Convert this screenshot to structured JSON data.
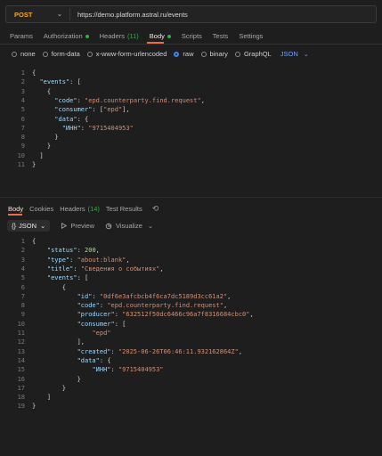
{
  "request": {
    "method": "POST",
    "url": "https://demo.platform.astral.ru/events"
  },
  "request_tabs": [
    {
      "label": "Params"
    },
    {
      "label": "Authorization",
      "dot": true
    },
    {
      "label": "Headers",
      "count": "(11)"
    },
    {
      "label": "Body",
      "dot": true,
      "active": true
    },
    {
      "label": "Scripts"
    },
    {
      "label": "Tests"
    },
    {
      "label": "Settings"
    }
  ],
  "body_types": [
    "none",
    "form-data",
    "x-www-form-urlencoded",
    "raw",
    "binary",
    "GraphQL"
  ],
  "body_format": "JSON",
  "request_body": [
    {
      "n": "1",
      "t": "{"
    },
    {
      "n": "2",
      "t": "  \"events\": ["
    },
    {
      "n": "3",
      "t": "    {"
    },
    {
      "n": "4",
      "t": "      \"code\": \"epd.counterparty.find.request\","
    },
    {
      "n": "5",
      "t": "      \"consumer\": [\"epd\"],"
    },
    {
      "n": "6",
      "t": "      \"data\": {"
    },
    {
      "n": "7",
      "t": "        \"ИНН\": \"9715404953\""
    },
    {
      "n": "8",
      "t": "      }"
    },
    {
      "n": "9",
      "t": "    }"
    },
    {
      "n": "10",
      "t": "  ]"
    },
    {
      "n": "11",
      "t": "}"
    }
  ],
  "response_tabs": [
    {
      "label": "Body",
      "active": true
    },
    {
      "label": "Cookies"
    },
    {
      "label": "Headers",
      "count": "(14)"
    },
    {
      "label": "Test Results"
    }
  ],
  "response_toolbar": {
    "format": "JSON",
    "preview": "Preview",
    "visualize": "Visualize"
  },
  "response_body": [
    {
      "n": "1",
      "t": "{"
    },
    {
      "n": "2",
      "t": "    \"status\": 200,"
    },
    {
      "n": "3",
      "t": "    \"type\": \"about:blank\","
    },
    {
      "n": "4",
      "t": "    \"title\": \"Сведения о событиях\","
    },
    {
      "n": "5",
      "t": "    \"events\": ["
    },
    {
      "n": "6",
      "t": "        {"
    },
    {
      "n": "7",
      "t": "            \"id\": \"0df6e3afcbcb4f6ca7dc5189d3cc61a2\","
    },
    {
      "n": "8",
      "t": "            \"code\": \"epd.counterparty.find.request\","
    },
    {
      "n": "9",
      "t": "            \"producer\": \"632512f50dc6466c96a7f8316684cbc0\","
    },
    {
      "n": "10",
      "t": "            \"consumer\": ["
    },
    {
      "n": "11",
      "t": "                \"epd\""
    },
    {
      "n": "12",
      "t": "            ],"
    },
    {
      "n": "13",
      "t": "            \"created\": \"2025-06-26T06:46:11.932162864Z\","
    },
    {
      "n": "14",
      "t": "            \"data\": {"
    },
    {
      "n": "15",
      "t": "                \"ИНН\": \"9715404953\""
    },
    {
      "n": "16",
      "t": "            }"
    },
    {
      "n": "17",
      "t": "        }"
    },
    {
      "n": "18",
      "t": "    ]"
    },
    {
      "n": "19",
      "t": "}"
    }
  ],
  "colors": {
    "method": "#f0a81e",
    "accent": "#f26b3a",
    "success": "#2bb14c",
    "link": "#6fa1ff"
  }
}
